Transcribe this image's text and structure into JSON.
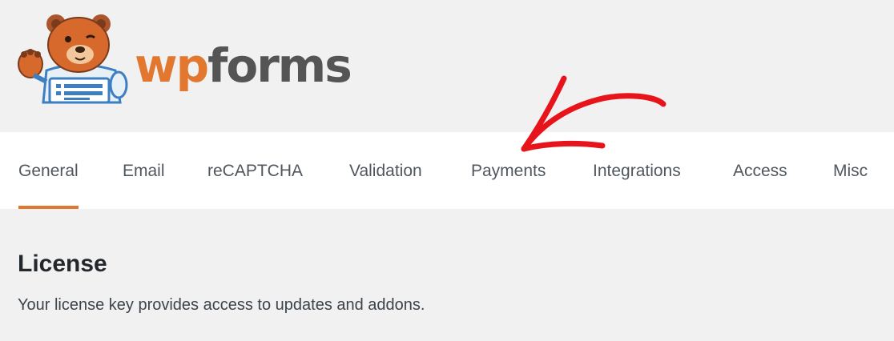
{
  "brand": {
    "name_prefix": "wp",
    "name_suffix": "forms",
    "primary_color": "#e27730",
    "text_color": "#555555",
    "mascot_icon": "bear-mascot-icon"
  },
  "tabs": [
    {
      "label": "General",
      "active": true
    },
    {
      "label": "Email",
      "active": false
    },
    {
      "label": "reCAPTCHA",
      "active": false
    },
    {
      "label": "Validation",
      "active": false
    },
    {
      "label": "Payments",
      "active": false
    },
    {
      "label": "Integrations",
      "active": false
    },
    {
      "label": "Access",
      "active": false
    },
    {
      "label": "Misc",
      "active": false
    }
  ],
  "annotation": {
    "icon": "red-arrow-icon",
    "color": "#e8141b"
  },
  "license": {
    "title": "License",
    "description": "Your license key provides access to updates and addons."
  }
}
